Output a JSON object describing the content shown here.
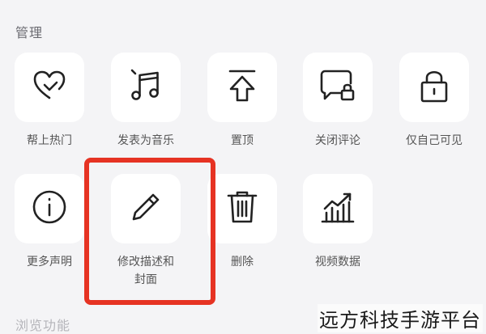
{
  "sections": {
    "manage_title": "管理",
    "browse_title": "浏览功能"
  },
  "row1": [
    {
      "label": "帮上热门",
      "icon": "heart-arrow-icon"
    },
    {
      "label": "发表为音乐",
      "icon": "music-note-icon"
    },
    {
      "label": "置顶",
      "icon": "pin-top-icon"
    },
    {
      "label": "关闭评论",
      "icon": "comment-lock-icon"
    },
    {
      "label": "仅自己可见",
      "icon": "lock-icon"
    }
  ],
  "row2": [
    {
      "label": "更多声明",
      "icon": "info-icon"
    },
    {
      "label": "修改描述和封面",
      "label_line1": "修改描述和",
      "label_line2": "封面",
      "icon": "pencil-icon"
    },
    {
      "label": "删除",
      "icon": "trash-icon"
    },
    {
      "label": "视频数据",
      "icon": "bar-chart-icon"
    }
  ],
  "watermark": "远方科技手游平台",
  "colors": {
    "highlight": "#e63323",
    "background": "#f4f4f6",
    "tile": "#ffffff"
  }
}
